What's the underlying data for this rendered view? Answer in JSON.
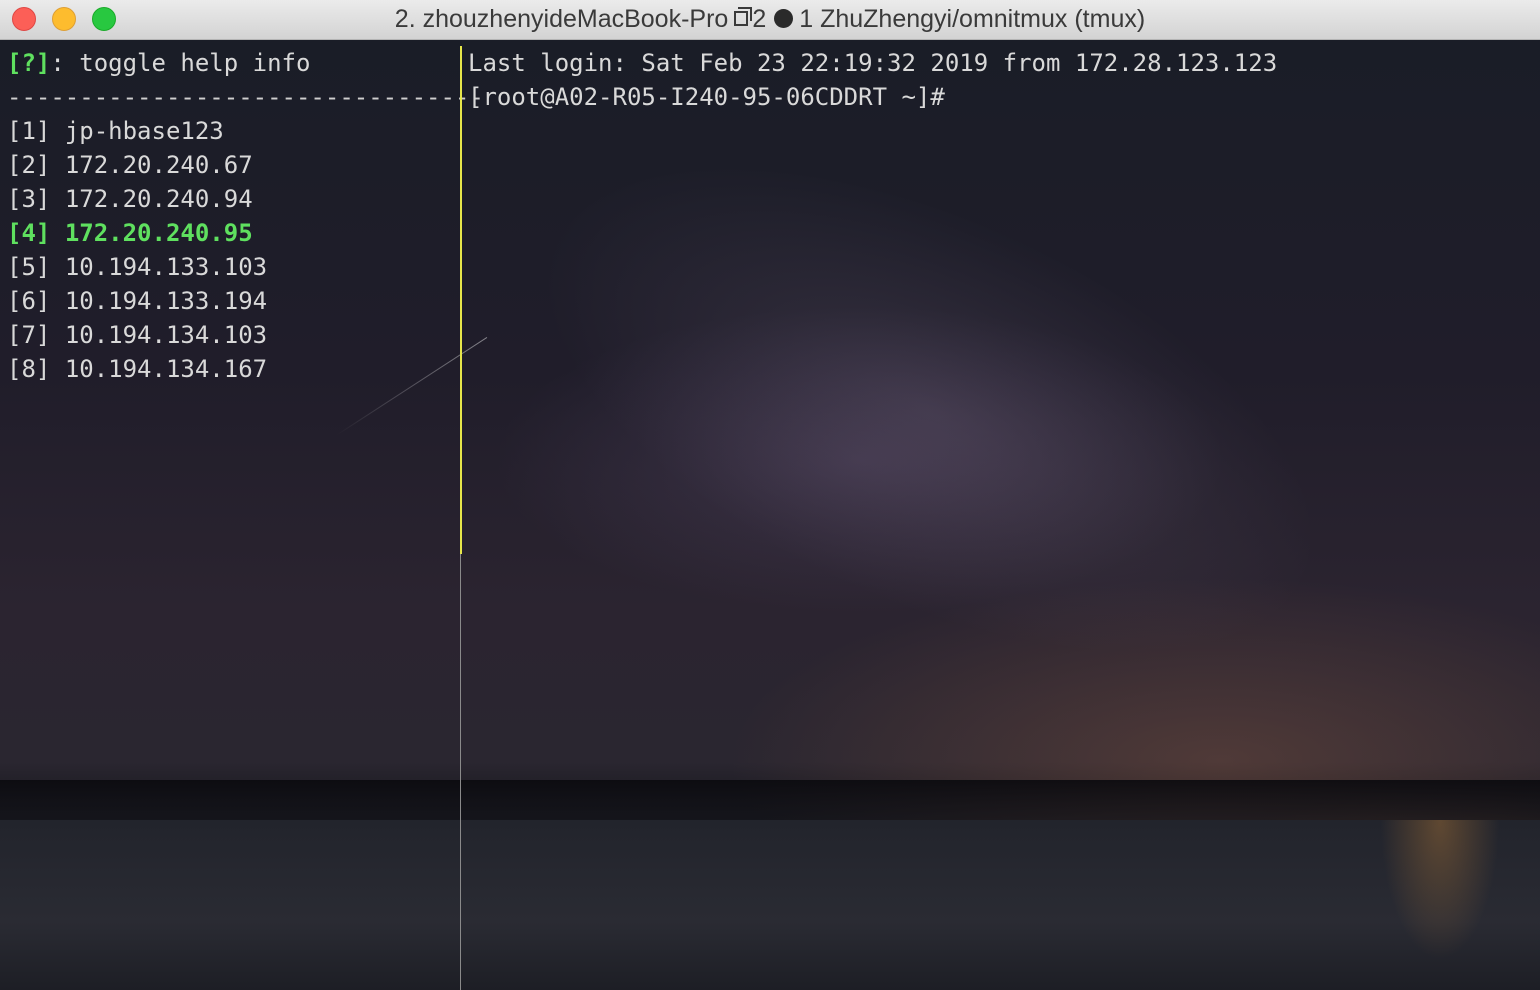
{
  "window": {
    "title_prefix": "2. zhouzhenyideMacBook-Pro",
    "title_window_count": "2",
    "title_session": "1 ZhuZhengyi/omnitmux (tmux)"
  },
  "left_pane": {
    "help_key": "[?]",
    "help_text": ": toggle help info",
    "divider": "---------------------------------",
    "hosts": [
      {
        "index": "[1]",
        "name": "jp-hbase123"
      },
      {
        "index": "[2]",
        "name": "172.20.240.67"
      },
      {
        "index": "[3]",
        "name": "172.20.240.94"
      },
      {
        "index": "[4]",
        "name": "172.20.240.95"
      },
      {
        "index": "[5]",
        "name": "10.194.133.103"
      },
      {
        "index": "[6]",
        "name": "10.194.133.194"
      },
      {
        "index": "[7]",
        "name": "10.194.134.103"
      },
      {
        "index": "[8]",
        "name": "10.194.134.167"
      }
    ],
    "selected_host": "[4]"
  },
  "right_pane": {
    "last_login": "Last login: Sat Feb 23 22:19:32 2019 from 172.28.123.123",
    "prompt": "[root@A02-R05-I240-95-06CDDRT ~]#"
  },
  "colors": {
    "highlight": "#5fe05f",
    "active_split": "#e6e64a",
    "text": "#d9d9d9"
  }
}
